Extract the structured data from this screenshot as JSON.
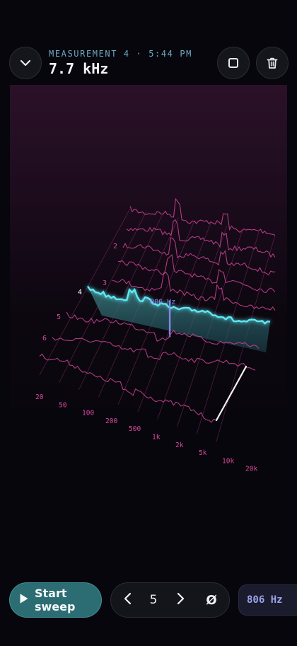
{
  "header": {
    "meta": "MEASUREMENT 4 · 5:44 PM",
    "frequency": "7.7 kHz",
    "icons": {
      "collapse": "chevron-down-icon",
      "stop": "stop-square-icon",
      "delete": "trash-icon"
    }
  },
  "waterfall": {
    "cursor_label": "806 Hz",
    "active_trace": "4",
    "trace_labels": [
      "2",
      "3",
      "4",
      "5",
      "6"
    ],
    "freq_ticks": [
      "20",
      "50",
      "100",
      "200",
      "500",
      "1k",
      "2k",
      "5k",
      "10k",
      "20k"
    ],
    "colors": {
      "accent": "#5ee8f2",
      "trace": "#c3408f",
      "grid": "#8a2f6e",
      "tick_text": "#d64a9c",
      "cursor": "#8b8ef0"
    }
  },
  "controls": {
    "start_label": "Start sweep",
    "page_number": "5",
    "prev_icon": "chevron-left-icon",
    "next_icon": "chevron-right-icon",
    "phase_symbol": "Ø",
    "marker_frequency": "806 Hz"
  }
}
